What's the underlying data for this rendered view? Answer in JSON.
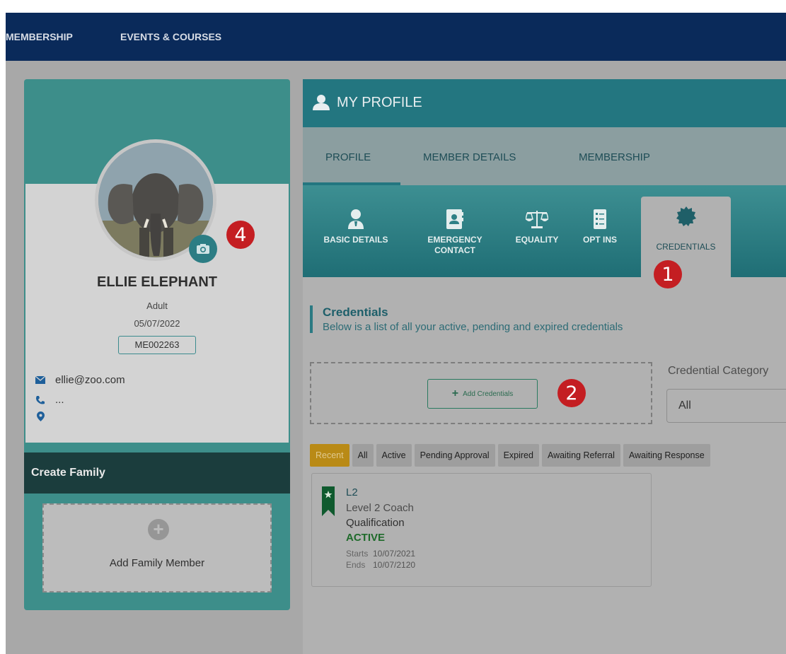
{
  "nav": {
    "items": [
      "MEMBERSHIP",
      "EVENTS & COURSES"
    ]
  },
  "profile_card": {
    "name": "ELLIE ELEPHANT",
    "category": "Adult",
    "date": "05/07/2022",
    "member_number": "ME002263",
    "email": "ellie@zoo.com",
    "phone": "...",
    "location": ""
  },
  "family": {
    "header": "Create Family",
    "add_label": "Add Family Member"
  },
  "panel": {
    "title": "MY PROFILE",
    "tabs": [
      "PROFILE",
      "MEMBER DETAILS",
      "MEMBERSHIP"
    ],
    "active_tab": "PROFILE",
    "sub_tabs": [
      {
        "label": "BASIC DETAILS",
        "icon": "person-id-icon"
      },
      {
        "label": "EMERGENCY CONTACT",
        "icon": "contact-card-icon"
      },
      {
        "label": "EQUALITY",
        "icon": "scales-icon"
      },
      {
        "label": "OPT INS",
        "icon": "checklist-icon"
      },
      {
        "label": "CREDENTIALS",
        "icon": "seal-icon"
      }
    ],
    "active_sub_tab": "CREDENTIALS"
  },
  "credentials": {
    "title": "Credentials",
    "description": "Below is a list of all your active, pending and expired credentials",
    "add_button": "Add Credentials",
    "category_label": "Credential Category",
    "category_value": "All",
    "filters": [
      "Recent",
      "All",
      "Active",
      "Pending Approval",
      "Expired",
      "Awaiting Referral",
      "Awaiting Response"
    ],
    "active_filter": "Recent",
    "items": [
      {
        "code": "L2",
        "name": "Level 2 Coach",
        "type": "Qualification",
        "status": "ACTIVE",
        "starts_label": "Starts",
        "starts": "10/07/2021",
        "ends_label": "Ends",
        "ends": "10/07/2120"
      }
    ]
  },
  "annotations": [
    "1",
    "2",
    "4"
  ],
  "colors": {
    "nav": "#0a2a5a",
    "teal": "#237680",
    "active_filter": "#b98a16",
    "badge": "#c41e22",
    "status_active": "#1e6a2a"
  }
}
